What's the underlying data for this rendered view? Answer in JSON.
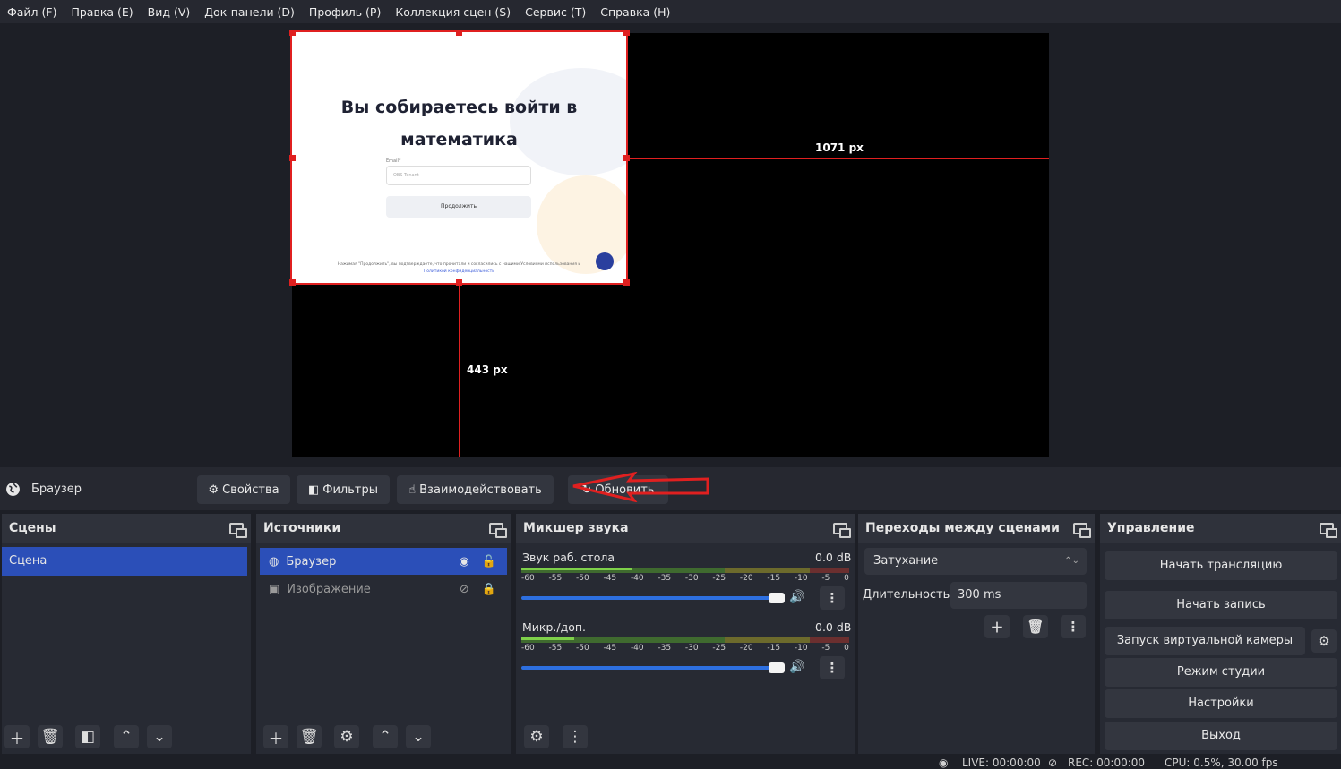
{
  "menu": [
    "Файл (F)",
    "Правка (E)",
    "Вид (V)",
    "Док-панели (D)",
    "Профиль (P)",
    "Коллекция сцен (S)",
    "Сервис (T)",
    "Справка (H)"
  ],
  "preview": {
    "heading_line1": "Вы собираетесь войти в",
    "heading_line2": "математика",
    "field_label": "Email*",
    "field_placeholder": "OBS Tenant",
    "continue_button": "Продолжить",
    "footer_line1": "Нажимая \"Продолжить\", вы подтверждаете, что прочитали и согласились с нашими Условиями использования и",
    "footer_line2": "Политикой конфиденциальности",
    "guide_h_label": "1071 px",
    "guide_v_label": "443 px"
  },
  "context_bar": {
    "source_name": "Браузер",
    "properties": "Свойства",
    "filters": "Фильтры",
    "interact": "Взаимодействовать",
    "refresh": "Обновить"
  },
  "scenes": {
    "title": "Сцены",
    "items": [
      "Сцена"
    ]
  },
  "sources": {
    "title": "Источники",
    "items": [
      "Браузер",
      "Изображение"
    ]
  },
  "mixer": {
    "title": "Микшер звука",
    "scale": [
      "-60",
      "-55",
      "-50",
      "-45",
      "-40",
      "-35",
      "-30",
      "-25",
      "-20",
      "-15",
      "-10",
      "-5",
      "0"
    ],
    "channels": [
      {
        "name": "Звук раб. стола",
        "db": "0.0 dB"
      },
      {
        "name": "Микр./доп.",
        "db": "0.0 dB"
      }
    ]
  },
  "transitions": {
    "title": "Переходы между сценами",
    "selected": "Затухание",
    "duration_label": "Длительность",
    "duration_value": "300 ms"
  },
  "controls": {
    "title": "Управление",
    "start_stream": "Начать трансляцию",
    "start_record": "Начать запись",
    "virtual_cam": "Запуск виртуальной камеры",
    "studio_mode": "Режим студии",
    "settings": "Настройки",
    "exit": "Выход"
  },
  "status": {
    "live": "LIVE: 00:00:00",
    "rec": "REC: 00:00:00",
    "cpu": "CPU: 0.5%, 30.00 fps"
  },
  "colors": {
    "accent": "#2b4fb8",
    "guide": "#e02020"
  }
}
